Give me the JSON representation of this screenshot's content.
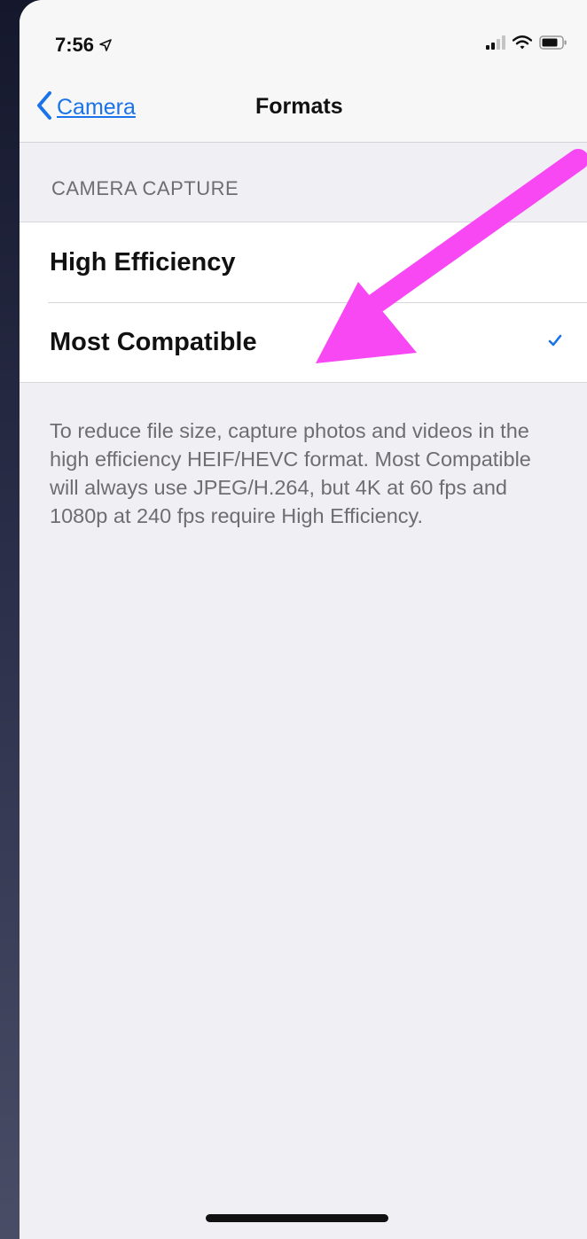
{
  "status_bar": {
    "time": "7:56"
  },
  "nav": {
    "back_label": "Camera",
    "title": "Formats"
  },
  "section": {
    "header": "CAMERA CAPTURE",
    "options": [
      {
        "label": "High Efficiency",
        "selected": false
      },
      {
        "label": "Most Compatible",
        "selected": true
      }
    ],
    "footer": "To reduce file size, capture photos and videos in the high efficiency HEIF/HEVC format. Most Compatible will always use JPEG/H.264, but 4K at 60 fps and 1080p at 240 fps require High Efficiency."
  },
  "colors": {
    "accent": "#1a73e8",
    "annotation_arrow": "#f748f4",
    "background": "#efeff4"
  },
  "icons": {
    "back": "chevron-left-icon",
    "location": "location-arrow-icon",
    "signal": "cellular-signal-icon",
    "wifi": "wifi-icon",
    "battery": "battery-icon",
    "check": "checkmark-icon"
  }
}
